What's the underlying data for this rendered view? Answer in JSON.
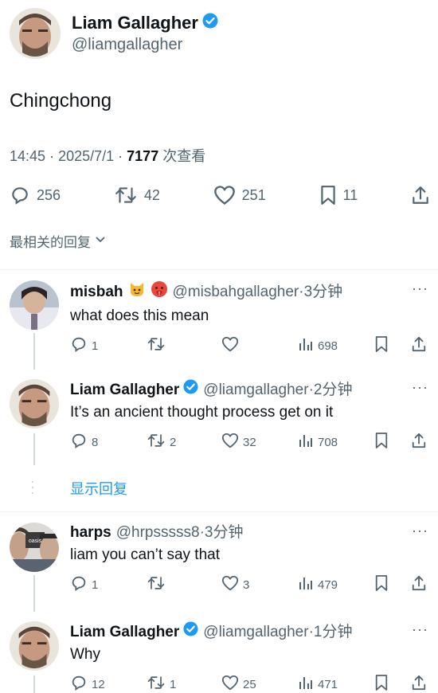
{
  "main_tweet": {
    "author_name": "Liam Gallagher",
    "author_handle": "@liamgallagher",
    "text": "Chingchong",
    "time": "14:45",
    "date": "2025/7/1",
    "views_count": "7177",
    "views_label": "次查看",
    "stats": {
      "replies": "256",
      "retweets": "42",
      "likes": "251",
      "bookmarks": "11"
    }
  },
  "sort_label": "最相关的回复",
  "show_replies_label": "显示回复",
  "replies": [
    {
      "name": "misbah",
      "handle": "@misbahgallagher",
      "time": "3分钟",
      "text": "what does this mean",
      "replies": "1",
      "retweets": "",
      "likes": "",
      "views": "698"
    },
    {
      "name": "Liam Gallagher",
      "handle": "@liamgallagher",
      "time": "2分钟",
      "text": "It’s an ancient thought process get on it",
      "replies": "8",
      "retweets": "2",
      "likes": "32",
      "views": "708"
    },
    {
      "name": "harps",
      "handle": "@hrpsssss8",
      "time": "3分钟",
      "text": "liam you can’t say that",
      "replies": "1",
      "retweets": "",
      "likes": "3",
      "views": "479"
    },
    {
      "name": "Liam Gallagher",
      "handle": "@liamgallagher",
      "time": "1分钟",
      "text": "Why",
      "replies": "12",
      "retweets": "1",
      "likes": "25",
      "views": "471"
    }
  ],
  "colors": {
    "accent": "#1d9bf0",
    "text": "#0f1419",
    "secondary": "#536471",
    "divider": "#eff3f4"
  }
}
